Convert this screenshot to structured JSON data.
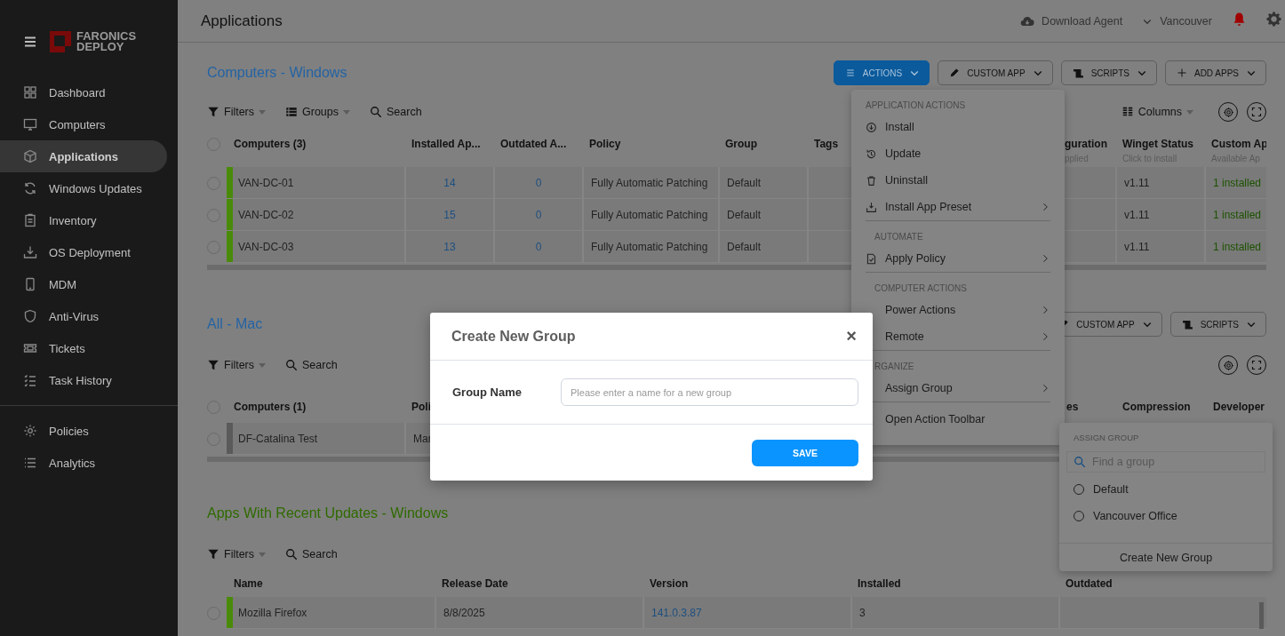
{
  "sidebar": {
    "logo": {
      "line1": "FARONICS",
      "line2": "DEPLOY"
    },
    "items": [
      {
        "label": "Dashboard",
        "kind": "dashboard",
        "selected": false
      },
      {
        "label": "Computers",
        "kind": "computers",
        "selected": false
      },
      {
        "label": "Applications",
        "kind": "applications",
        "selected": true
      },
      {
        "label": "Windows Updates",
        "kind": "updates",
        "selected": false
      },
      {
        "label": "Inventory",
        "kind": "inventory",
        "selected": false
      },
      {
        "label": "OS Deployment",
        "kind": "os",
        "selected": false
      },
      {
        "label": "MDM",
        "kind": "mdm",
        "selected": false
      },
      {
        "label": "Anti-Virus",
        "kind": "antivirus",
        "selected": false
      },
      {
        "label": "Tickets",
        "kind": "tickets",
        "selected": false
      },
      {
        "label": "Task History",
        "kind": "history",
        "selected": false
      }
    ],
    "footer_items": [
      {
        "label": "Policies",
        "kind": "policies",
        "selected": false
      },
      {
        "label": "Analytics",
        "kind": "analytics",
        "selected": false
      }
    ]
  },
  "header": {
    "title": "Applications",
    "download": "Download Agent",
    "location": "Vancouver"
  },
  "sections": [
    {
      "kind": "computers",
      "title": "Computers - Windows",
      "color": "#2363a3",
      "buttons": [
        {
          "label": "ACTIONS",
          "kind": "menu"
        },
        {
          "label": "CUSTOM APP",
          "kind": "edit"
        },
        {
          "label": "SCRIPTS",
          "kind": "scripts"
        },
        {
          "label": "ADD APPS",
          "kind": "add"
        }
      ],
      "tools": [
        {
          "label": "Filters",
          "kind": "filter",
          "dropdown": true
        },
        {
          "label": "Groups",
          "kind": "groups",
          "dropdown": true
        },
        {
          "label": "Search",
          "kind": "search",
          "dropdown": false
        }
      ],
      "columns_label": "Columns",
      "header_checkbox": true,
      "all_checked": false,
      "columns": [
        {
          "label": "Computers (3)"
        },
        {
          "label": "Installed Ap..."
        },
        {
          "label": "Outdated A..."
        },
        {
          "label": "Policy"
        },
        {
          "label": "Group"
        },
        {
          "label": "Tags"
        },
        {
          "label": "guration",
          "sub": "pplied"
        },
        {
          "label": "Winget Status",
          "sub": "Click to install"
        },
        {
          "label": "Custom Ap",
          "sub": "Available Ap"
        }
      ],
      "rows": [
        {
          "color": "#4a8a0a",
          "checked": false,
          "cells": [
            {
              "text": "VAN-DC-01",
              "kind": "text"
            },
            {
              "text": "14",
              "kind": "link"
            },
            {
              "text": "0",
              "kind": "link"
            },
            {
              "text": "Fully Automatic Patching",
              "kind": "text"
            },
            {
              "text": "Default",
              "kind": "text"
            },
            {
              "text": "",
              "kind": "text"
            },
            {
              "text": "",
              "kind": "text"
            },
            {
              "text": "v1.11",
              "kind": "text"
            },
            {
              "text": "1 installed",
              "kind": "ok"
            }
          ]
        },
        {
          "color": "#4a8a0a",
          "checked": false,
          "cells": [
            {
              "text": "VAN-DC-02",
              "kind": "text"
            },
            {
              "text": "15",
              "kind": "link"
            },
            {
              "text": "0",
              "kind": "link"
            },
            {
              "text": "Fully Automatic Patching",
              "kind": "text"
            },
            {
              "text": "Default",
              "kind": "text"
            },
            {
              "text": "",
              "kind": "text"
            },
            {
              "text": "",
              "kind": "text"
            },
            {
              "text": "v1.11",
              "kind": "text"
            },
            {
              "text": "1 installed",
              "kind": "ok"
            }
          ]
        },
        {
          "color": "#4a8a0a",
          "checked": false,
          "cells": [
            {
              "text": "VAN-DC-03",
              "kind": "text"
            },
            {
              "text": "13",
              "kind": "link"
            },
            {
              "text": "0",
              "kind": "link"
            },
            {
              "text": "Fully Automatic Patching",
              "kind": "text"
            },
            {
              "text": "Default",
              "kind": "text"
            },
            {
              "text": "",
              "kind": "text"
            },
            {
              "text": "",
              "kind": "text"
            },
            {
              "text": "v1.11",
              "kind": "text"
            },
            {
              "text": "1 installed",
              "kind": "ok"
            }
          ]
        }
      ]
    },
    {
      "kind": "computers",
      "title": "All - Mac",
      "color": "#2363a3",
      "buttons": [
        {
          "label": "CUSTOM APP",
          "kind": "edit"
        },
        {
          "label": "SCRIPTS",
          "kind": "scripts"
        }
      ],
      "tools": [
        {
          "label": "Filters",
          "kind": "filter",
          "dropdown": true
        },
        {
          "label": "Search",
          "kind": "search",
          "dropdown": false
        }
      ],
      "header_checkbox": true,
      "all_checked": false,
      "columns": [
        {
          "label": "Computers (1)"
        },
        {
          "label": "Poli"
        },
        {
          "label": "es"
        },
        {
          "label": "Compression"
        },
        {
          "label": "Developer"
        }
      ],
      "rows": [
        {
          "color": "#5a5a5a",
          "checked": false,
          "cells": [
            {
              "text": "DF-Catalina Test",
              "kind": "text"
            },
            {
              "text": "Mar",
              "kind": "text"
            },
            {
              "text": "",
              "kind": "text"
            },
            {
              "text": "",
              "kind": "text"
            },
            {
              "text": "",
              "kind": "text"
            }
          ]
        }
      ]
    },
    {
      "kind": "apps",
      "title": "Apps With Recent Updates - Windows",
      "color": "#2f6a00",
      "tools": [
        {
          "label": "Filters",
          "kind": "filter",
          "dropdown": true
        },
        {
          "label": "Search",
          "kind": "search",
          "dropdown": false
        }
      ],
      "header_checkbox": false,
      "columns": [
        {
          "label": "Name"
        },
        {
          "label": "Release Date"
        },
        {
          "label": "Version"
        },
        {
          "label": "Installed"
        },
        {
          "label": "Outdated"
        }
      ],
      "rows": [
        {
          "color": "#4a8a0a",
          "checked": false,
          "cells": [
            {
              "text": "Mozilla Firefox",
              "kind": "text"
            },
            {
              "text": "8/8/2025",
              "kind": "text"
            },
            {
              "text": "141.0.3.87",
              "kind": "link"
            },
            {
              "text": "3",
              "kind": "text"
            },
            {
              "text": "",
              "kind": "text"
            }
          ]
        }
      ]
    }
  ],
  "actions_menu": {
    "groups": [
      {
        "header": "APPLICATION ACTIONS",
        "items": [
          {
            "label": "Install",
            "kind": "install",
            "submenu": false
          },
          {
            "label": "Update",
            "kind": "update",
            "submenu": false
          },
          {
            "label": "Uninstall",
            "kind": "uninstall",
            "submenu": false
          },
          {
            "label": "Install App Preset",
            "kind": "preset",
            "submenu": true
          }
        ]
      },
      {
        "header": "AUTOMATE",
        "items": [
          {
            "label": "Apply Policy",
            "kind": "policy",
            "submenu": true
          }
        ]
      },
      {
        "header": "COMPUTER ACTIONS",
        "items": [
          {
            "label": "Power Actions",
            "submenu": true
          },
          {
            "label": "Remote",
            "submenu": true
          }
        ]
      },
      {
        "header": "RGANIZE",
        "items": [
          {
            "label": "Assign Group",
            "submenu": true
          }
        ]
      },
      {
        "items": [
          {
            "label": "Open Action Toolbar",
            "submenu": false
          }
        ]
      }
    ]
  },
  "assign_group": {
    "header": "ASSIGN GROUP",
    "placeholder": "Find a group",
    "options": [
      {
        "label": "Default",
        "selected": false
      },
      {
        "label": "Vancouver Office",
        "selected": false
      }
    ],
    "footer": "Create New Group"
  },
  "modal": {
    "title": "Create New Group",
    "close": "×",
    "label": "Group Name",
    "placeholder": "Please enter a name for a new group",
    "button": "SAVE"
  }
}
